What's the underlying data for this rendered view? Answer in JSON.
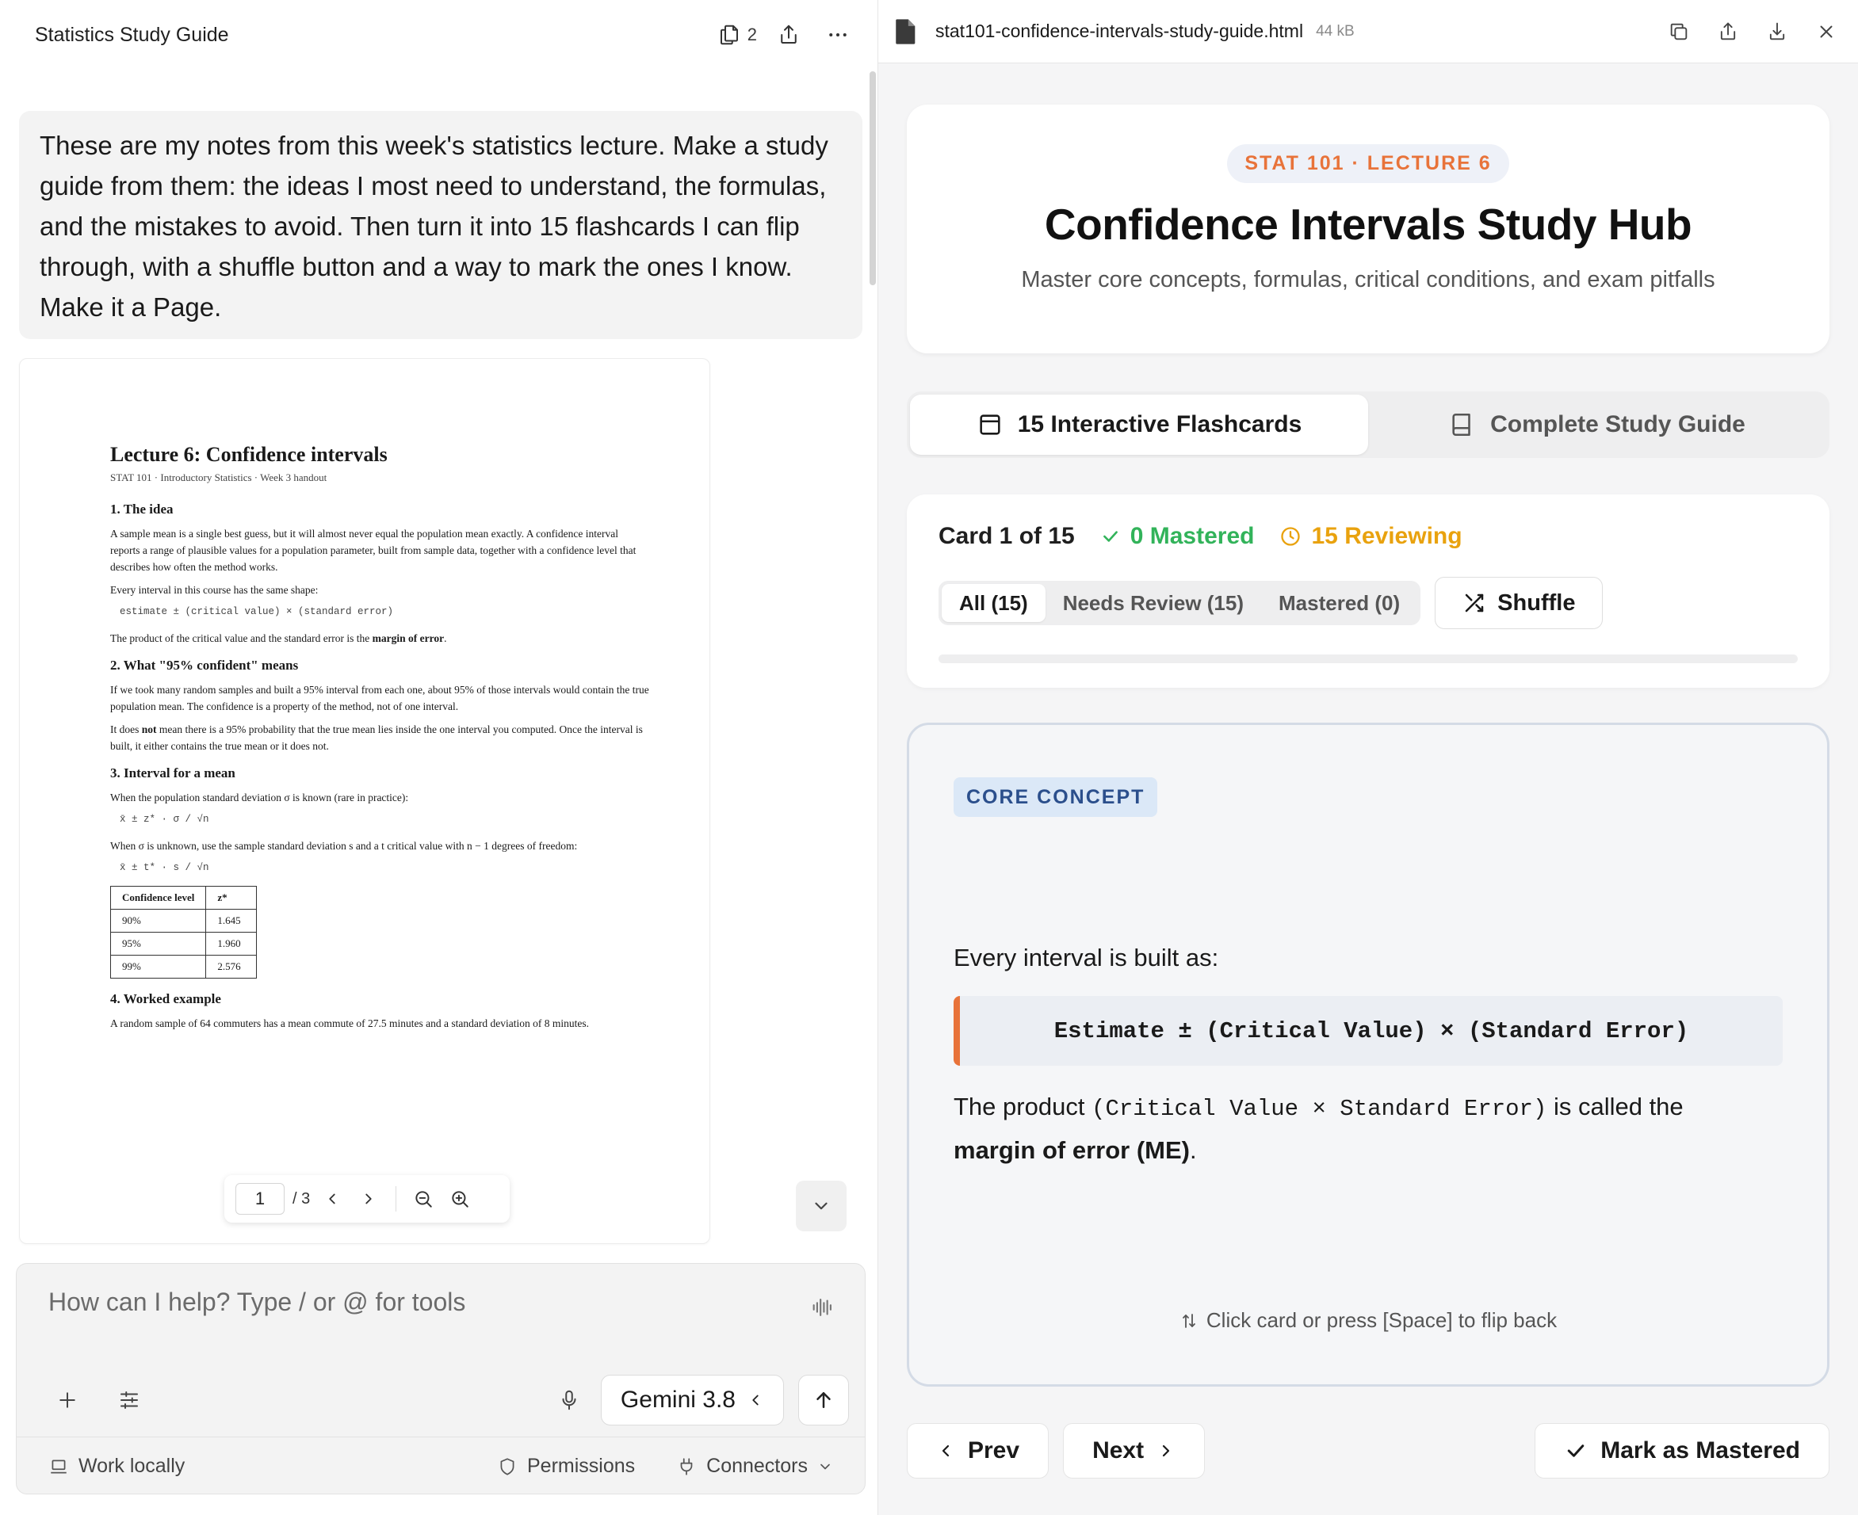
{
  "left": {
    "title": "Statistics Study Guide",
    "file_count": "2",
    "user_message": "These are my notes from this week's statistics lecture. Make a study guide from them: the ideas I most need to understand, the formulas, and the mistakes to avoid. Then turn it into 15 flashcards I can flip through, with a shuffle button and a way to mark the ones I know. Make it a Page.",
    "pdf": {
      "title": "Lecture 6: Confidence intervals",
      "subtitle": "STAT 101 · Introductory Statistics · Week 3 handout",
      "s1_heading": "1. The idea",
      "s1_p1": "A sample mean is a single best guess, but it will almost never equal the population mean exactly. A confidence interval reports a range of plausible values for a population parameter, built from sample data, together with a confidence level that describes how often the method works.",
      "s1_p2": "Every interval in this course has the same shape:",
      "s1_formula": "estimate ± (critical value) × (standard error)",
      "s1_p3_pre": "The product of the critical value and the standard error is the ",
      "s1_p3_bold": "margin of error",
      "s1_p3_post": ".",
      "s2_heading": "2. What \"95% confident\" means",
      "s2_p1": "If we took many random samples and built a 95% interval from each one, about 95% of those intervals would contain the true population mean. The confidence is a property of the method, not of one interval.",
      "s2_p2_pre": "It does ",
      "s2_p2_bold": "not",
      "s2_p2_post": " mean there is a 95% probability that the true mean lies inside the one interval you computed. Once the interval is built, it either contains the true mean or it does not.",
      "s3_heading": "3. Interval for a mean",
      "s3_p1": "When the population standard deviation σ is known (rare in practice):",
      "s3_formula1": "x̄ ± z* · σ / √n",
      "s3_p2": "When σ is unknown, use the sample standard deviation s and a t critical value with n − 1 degrees of freedom:",
      "s3_formula2": "x̄ ± t* · s / √n",
      "table_headers": [
        "Confidence level",
        "z*"
      ],
      "table_rows": [
        [
          "90%",
          "1.645"
        ],
        [
          "95%",
          "1.960"
        ],
        [
          "99%",
          "2.576"
        ]
      ],
      "s4_heading": "4. Worked example",
      "s4_p1": "A random sample of 64 commuters has a mean commute of 27.5 minutes and a standard deviation of 8 minutes."
    },
    "pdf_toolbar": {
      "page": "1",
      "total": "/ 3"
    },
    "composer": {
      "placeholder": "How can I help? Type / or @ for tools",
      "model": "Gemini 3.8",
      "work_locally": "Work locally",
      "permissions": "Permissions",
      "connectors": "Connectors"
    }
  },
  "right": {
    "file_name": "stat101-confidence-intervals-study-guide.html",
    "file_size": "44 kB",
    "hero": {
      "pill": "STAT 101 · LECTURE 6",
      "title": "Confidence Intervals Study Hub",
      "subtitle": "Master core concepts, formulas, critical conditions, and exam pitfalls"
    },
    "tabs": [
      "15 Interactive Flashcards",
      "Complete Study Guide"
    ],
    "status": {
      "card_label": "Card 1 of 15",
      "mastered": "0 Mastered",
      "reviewing": "15 Reviewing",
      "filters": [
        "All (15)",
        "Needs Review (15)",
        "Mastered (0)"
      ],
      "shuffle": "Shuffle",
      "progress": 0
    },
    "card": {
      "badge": "CORE CONCEPT",
      "lead": "Every interval is built as:",
      "formula": "Estimate ± (Critical Value) × (Standard Error)",
      "body_pre": "The product ",
      "body_code": "(Critical Value × Standard Error)",
      "body_mid": " is called the ",
      "body_bold": "margin of error (ME)",
      "body_post": ".",
      "flip_hint": "Click card or press [Space] to flip back"
    },
    "nav": {
      "prev": "Prev",
      "next": "Next",
      "mark": "Mark as Mastered"
    }
  },
  "colors": {
    "accent_orange": "#e8733a",
    "mastered_green": "#32b35a",
    "reviewing_amber": "#e9a20e",
    "badge_blue": "#2b4f8c"
  }
}
